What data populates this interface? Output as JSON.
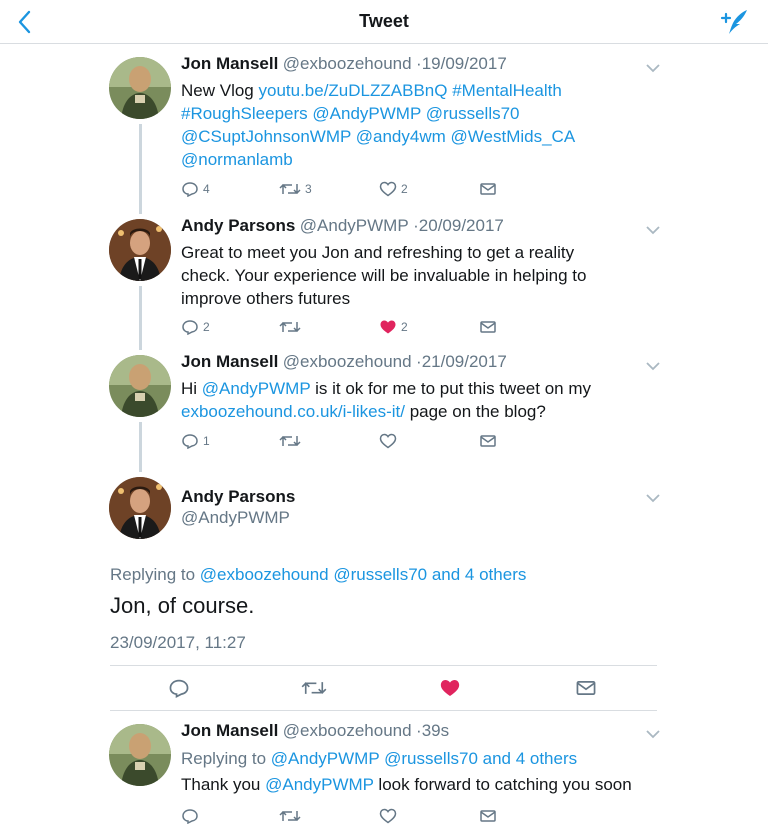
{
  "header": {
    "title": "Tweet"
  },
  "tweets": [
    {
      "name": "Jon Mansell",
      "handle": "@exboozehound",
      "sep": "·",
      "time": "19/09/2017",
      "lines": [
        [
          {
            "t": "New Vlog ",
            "c": "text"
          },
          {
            "t": "youtu.be/ZuDLZZABBnQ",
            "c": "link"
          },
          {
            "t": " ",
            "c": "text"
          },
          {
            "t": "#MentalHealth",
            "c": "link"
          }
        ],
        [
          {
            "t": "#RoughSleepers",
            "c": "link"
          },
          {
            "t": " ",
            "c": "text"
          },
          {
            "t": "@AndyPWMP",
            "c": "link"
          },
          {
            "t": " ",
            "c": "text"
          },
          {
            "t": "@russells70",
            "c": "link"
          }
        ],
        [
          {
            "t": "@CSuptJohnsonWMP",
            "c": "link"
          },
          {
            "t": " ",
            "c": "text"
          },
          {
            "t": "@andy4wm",
            "c": "link"
          },
          {
            "t": " ",
            "c": "text"
          },
          {
            "t": "@WestMids_CA",
            "c": "link"
          }
        ],
        [
          {
            "t": "@normanlamb",
            "c": "link"
          }
        ]
      ],
      "replies": "4",
      "retweets": "3",
      "likes": "2",
      "liked": false
    },
    {
      "name": "Andy Parsons",
      "handle": "@AndyPWMP",
      "sep": "·",
      "time": "20/09/2017",
      "lines": [
        [
          {
            "t": "Great to meet you Jon and refreshing to get a reality",
            "c": "text"
          }
        ],
        [
          {
            "t": "check. Your experience will be invaluable in helping to",
            "c": "text"
          }
        ],
        [
          {
            "t": "improve others futures",
            "c": "text"
          }
        ]
      ],
      "replies": "2",
      "retweets": "",
      "likes": "2",
      "liked": true
    },
    {
      "name": "Jon Mansell",
      "handle": "@exboozehound",
      "sep": "·",
      "time": "21/09/2017",
      "lines": [
        [
          {
            "t": "Hi ",
            "c": "text"
          },
          {
            "t": "@AndyPWMP",
            "c": "link"
          },
          {
            "t": " is it ok for me to put this tweet on my",
            "c": "text"
          }
        ],
        [
          {
            "t": "exboozehound.co.uk/i-likes-it/",
            "c": "link"
          },
          {
            "t": " page on the blog?",
            "c": "text"
          }
        ]
      ],
      "replies": "1",
      "retweets": "",
      "likes": "",
      "liked": false
    }
  ],
  "focused": {
    "name": "Andy Parsons",
    "handle": "@AndyPWMP",
    "replying_prefix": "Replying to",
    "replying_to": "@exboozehound @russells70 and 4 others",
    "text": "Jon, of course.",
    "timestamp": "23/09/2017, 11:27",
    "liked": true
  },
  "reply": {
    "name": "Jon Mansell",
    "handle": "@exboozehound",
    "sep": "·",
    "time": "39s",
    "replying_prefix": "Replying to",
    "replying_to": "@AndyPWMP @russells70 and 4 others",
    "text_before": "Thank you ",
    "mention": "@AndyPWMP",
    "text_after": " look forward to catching you soon"
  },
  "colors": {
    "link": "#1b95e0",
    "like": "#e0245e",
    "secondary": "#657786",
    "thread_line": "#ccd6dd"
  }
}
